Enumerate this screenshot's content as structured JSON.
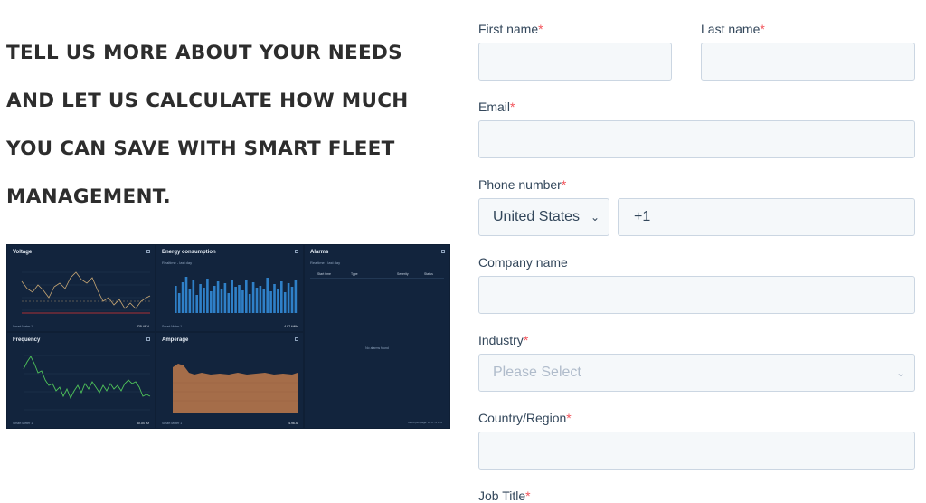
{
  "headline": {
    "lines": [
      "TELL US MORE ABOUT YOUR NEEDS",
      "AND LET US CALCULATE HOW MUCH",
      "YOU CAN SAVE WITH SMART FLEET",
      "MANAGEMENT."
    ]
  },
  "dashboard": {
    "panels": {
      "voltage": {
        "title": "Voltage",
        "legend": "Smart Meter 1",
        "foot": "225.46 V"
      },
      "energy": {
        "title": "Energy consumption",
        "subtitle": "Realtime - last day",
        "legend": "Smart Meter 1",
        "foot": "4.97 kWh"
      },
      "alarms": {
        "title": "Alarms",
        "subtitle": "Realtime - last day",
        "columns": [
          "Start time",
          "Type",
          "Severity",
          "Status"
        ],
        "empty": "No alarms found",
        "pager": "Items per page: 10   0 - 0 of 0"
      },
      "frequency": {
        "title": "Frequency",
        "legend": "Smart Meter 1",
        "foot": "50.04 Hz"
      },
      "amperage": {
        "title": "Amperage",
        "legend": "Smart Meter 1",
        "foot": "4.96 A"
      }
    },
    "colors": {
      "bg": "#0f1f35",
      "panel": "#12243d",
      "voltage": "#c8a774",
      "energy": "#2f80c8",
      "frequency": "#4fc45a",
      "amperage": "#c07a4b"
    }
  },
  "form": {
    "required_mark": "*",
    "first_name": {
      "label": "First name",
      "value": ""
    },
    "last_name": {
      "label": "Last name",
      "value": ""
    },
    "email": {
      "label": "Email",
      "value": ""
    },
    "phone": {
      "label": "Phone number",
      "country": "United States",
      "value": "+1"
    },
    "company": {
      "label": "Company name",
      "value": ""
    },
    "industry": {
      "label": "Industry",
      "placeholder": "Please Select"
    },
    "country_region": {
      "label": "Country/Region",
      "value": ""
    },
    "job_title": {
      "label": "Job Title"
    },
    "colors": {
      "required": "#f2545b",
      "field_bg": "#f5f8fa",
      "field_border": "#cbd6e2",
      "text": "#33475b"
    }
  }
}
